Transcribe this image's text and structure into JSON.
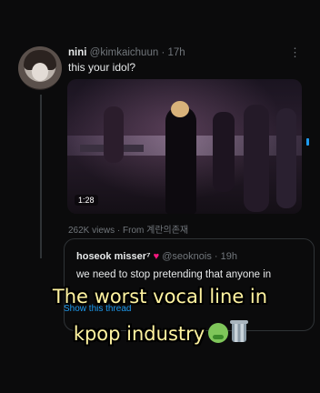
{
  "tweet": {
    "name": "nini",
    "handle": "@kimkaichuun",
    "time": "· 17h",
    "more_icon": "ellipsis-icon",
    "text": "this your idol?",
    "video_timestamp": "1:28",
    "views": "262K views · From 계란의존재"
  },
  "quote": {
    "name": "hoseok misser⁷",
    "heart": "♥",
    "handle": "@seoknois · 19h",
    "text": "we need to stop pretending that anyone in",
    "show_thread": "Show this thread"
  },
  "caption": {
    "line1": "The worst vocal line in",
    "line2": "kpop industry"
  },
  "colors": {
    "background": "#0b0b0c",
    "caption_text": "#fff3a0",
    "link": "#1d9bf0",
    "heart": "#f91880"
  }
}
